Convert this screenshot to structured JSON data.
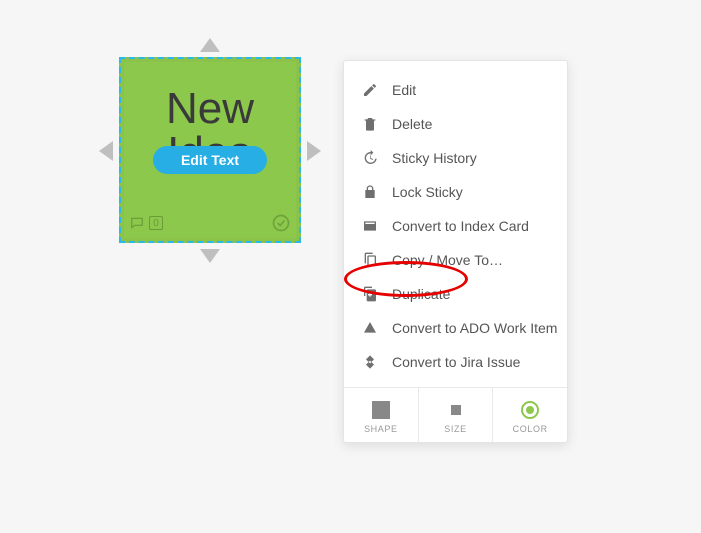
{
  "sticky": {
    "text_line1": "New",
    "text_line2": "Idea",
    "edit_pill": "Edit Text",
    "comment_count": "0",
    "bg_color": "#8cc84b",
    "selection_border": "#29b8e8"
  },
  "menu": {
    "items": [
      {
        "label": "Edit"
      },
      {
        "label": "Delete"
      },
      {
        "label": "Sticky History"
      },
      {
        "label": "Lock Sticky"
      },
      {
        "label": "Convert to Index Card"
      },
      {
        "label": "Copy / Move To…"
      },
      {
        "label": "Duplicate"
      },
      {
        "label": "Convert to ADO Work Item"
      },
      {
        "label": "Convert to Jira Issue"
      }
    ],
    "tabs": {
      "shape": "SHAPE",
      "size": "SIZE",
      "color": "COLOR"
    },
    "highlighted_index": 6
  }
}
